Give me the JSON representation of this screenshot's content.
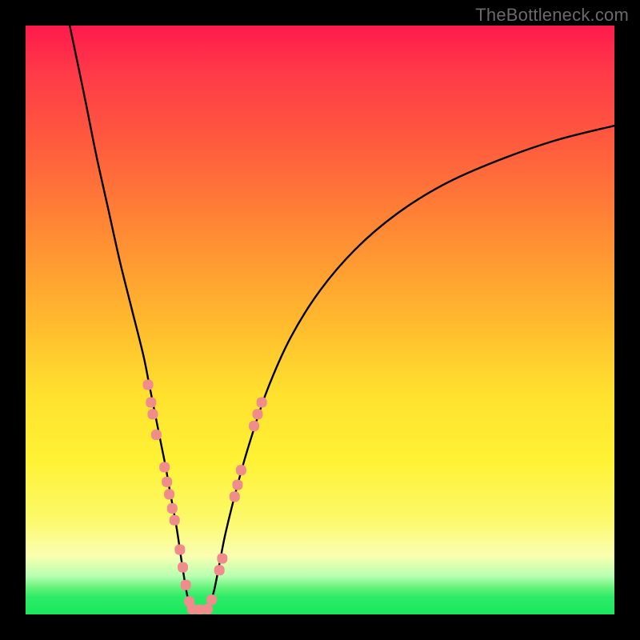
{
  "watermark": "TheBottleneck.com",
  "chart_data": {
    "type": "line",
    "title": "",
    "xlabel": "",
    "ylabel": "",
    "xlim": [
      0,
      100
    ],
    "ylim": [
      0,
      100
    ],
    "grid": false,
    "legend": false,
    "background_gradient": {
      "direction": "vertical",
      "stops": [
        {
          "pos": 0.0,
          "color": "#ff1a4d"
        },
        {
          "pos": 0.2,
          "color": "#ff5b3e"
        },
        {
          "pos": 0.5,
          "color": "#ffb92e"
        },
        {
          "pos": 0.74,
          "color": "#fff235"
        },
        {
          "pos": 0.9,
          "color": "#faffb1"
        },
        {
          "pos": 0.955,
          "color": "#62f27a"
        },
        {
          "pos": 1.0,
          "color": "#18e85e"
        }
      ]
    },
    "series": [
      {
        "name": "bottleneck-left",
        "color": "#000000",
        "width": 2.4,
        "x": [
          7.5,
          10,
          12,
          14,
          16,
          18,
          20,
          21,
          22,
          23,
          23.8,
          24.5,
          25.6,
          26.5,
          27.3,
          28
        ],
        "y": [
          100,
          88,
          78,
          69,
          60,
          52,
          44,
          39,
          34,
          29,
          25,
          21,
          15,
          9,
          4,
          0.8
        ]
      },
      {
        "name": "bottleneck-right",
        "color": "#000000",
        "width": 2.4,
        "x": [
          31,
          32,
          33,
          34,
          36,
          38,
          41,
          45,
          50,
          56,
          63,
          71,
          80,
          90,
          100
        ],
        "y": [
          0.8,
          4,
          9,
          14,
          22,
          29,
          38,
          47,
          55,
          62,
          68,
          73,
          77,
          80.5,
          83
        ]
      }
    ],
    "markers": [
      {
        "name": "dots-left",
        "color": "#f08c8c",
        "shape": "rounded-rect",
        "size": 13,
        "points": [
          {
            "x": 20.8,
            "y": 39
          },
          {
            "x": 21.3,
            "y": 36
          },
          {
            "x": 21.6,
            "y": 34
          },
          {
            "x": 22.2,
            "y": 30.5
          },
          {
            "x": 23.6,
            "y": 25
          },
          {
            "x": 24.0,
            "y": 22.5
          },
          {
            "x": 24.4,
            "y": 20.4
          },
          {
            "x": 24.9,
            "y": 18
          },
          {
            "x": 25.3,
            "y": 16
          },
          {
            "x": 26.2,
            "y": 11
          },
          {
            "x": 26.7,
            "y": 8
          },
          {
            "x": 27.2,
            "y": 5
          },
          {
            "x": 27.8,
            "y": 2.2
          }
        ]
      },
      {
        "name": "dots-bottom",
        "color": "#f08c8c",
        "shape": "rounded-rect",
        "size": 13,
        "points": [
          {
            "x": 28.3,
            "y": 0.9
          },
          {
            "x": 29.6,
            "y": 0.8
          },
          {
            "x": 30.9,
            "y": 0.9
          }
        ]
      },
      {
        "name": "dots-right",
        "color": "#f08c8c",
        "shape": "rounded-rect",
        "size": 13,
        "points": [
          {
            "x": 31.6,
            "y": 2.5
          },
          {
            "x": 32.9,
            "y": 7.5
          },
          {
            "x": 33.4,
            "y": 9.5
          },
          {
            "x": 35.5,
            "y": 20
          },
          {
            "x": 36.0,
            "y": 22
          },
          {
            "x": 36.6,
            "y": 24.5
          },
          {
            "x": 38.8,
            "y": 32
          },
          {
            "x": 39.4,
            "y": 34
          },
          {
            "x": 40.1,
            "y": 36
          }
        ]
      }
    ]
  }
}
